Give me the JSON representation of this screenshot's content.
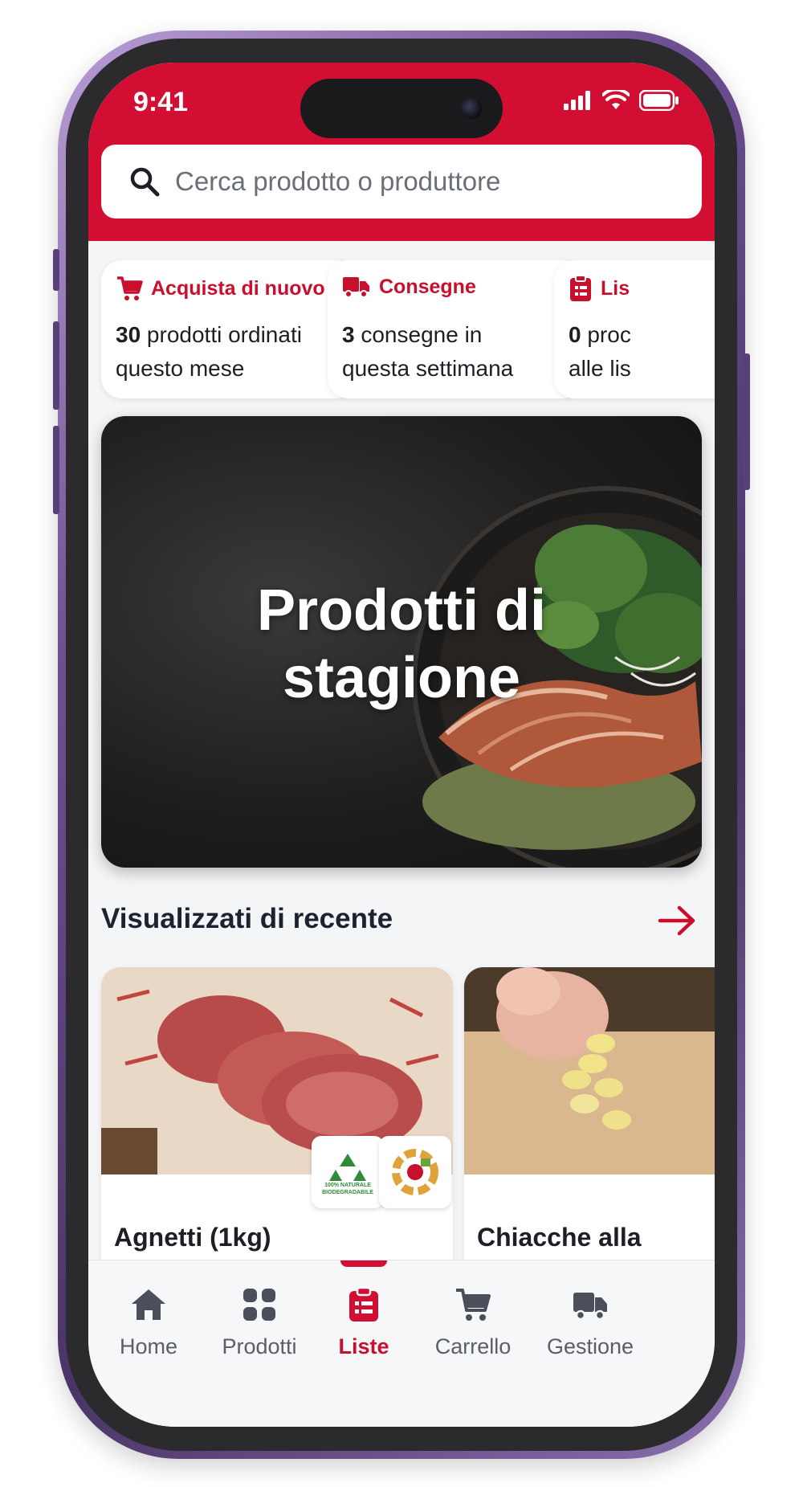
{
  "status_bar": {
    "time": "9:41"
  },
  "search": {
    "placeholder": "Cerca prodotto o produttore"
  },
  "stat_cards": [
    {
      "title": "Acquista di nuovo",
      "count": "30",
      "line1": " prodotti ordinati",
      "line2": "questo mese",
      "icon": "cart-icon"
    },
    {
      "title": "Consegne",
      "count": "3",
      "line1": " consegne in",
      "line2": "questa settimana",
      "icon": "truck-icon"
    },
    {
      "title": "Lis",
      "count": "0",
      "line1": " proc",
      "line2": "alle lis",
      "icon": "clipboard-icon"
    }
  ],
  "hero": {
    "title_line1": "Prodotti di",
    "title_line2": "stagione"
  },
  "recent": {
    "title": "Visualizzati di recente",
    "products": [
      {
        "name": "Agnetti (1kg)",
        "badges": [
          "100% NATURALE",
          "BIODEGRADABILE"
        ]
      },
      {
        "name": "Chiacche alla"
      }
    ]
  },
  "tabs": [
    {
      "label": "Home",
      "icon": "home-icon",
      "active": false
    },
    {
      "label": "Prodotti",
      "icon": "grid-icon",
      "active": false
    },
    {
      "label": "Liste",
      "icon": "clipboard-list-icon",
      "active": true
    },
    {
      "label": "Carrello",
      "icon": "cart-icon",
      "active": false
    },
    {
      "label": "Gestione",
      "icon": "truck-icon",
      "active": false
    }
  ],
  "colors": {
    "brand_red": "#d20f32",
    "text_dark": "#1c1f26",
    "tab_inactive": "#5a5e66"
  }
}
